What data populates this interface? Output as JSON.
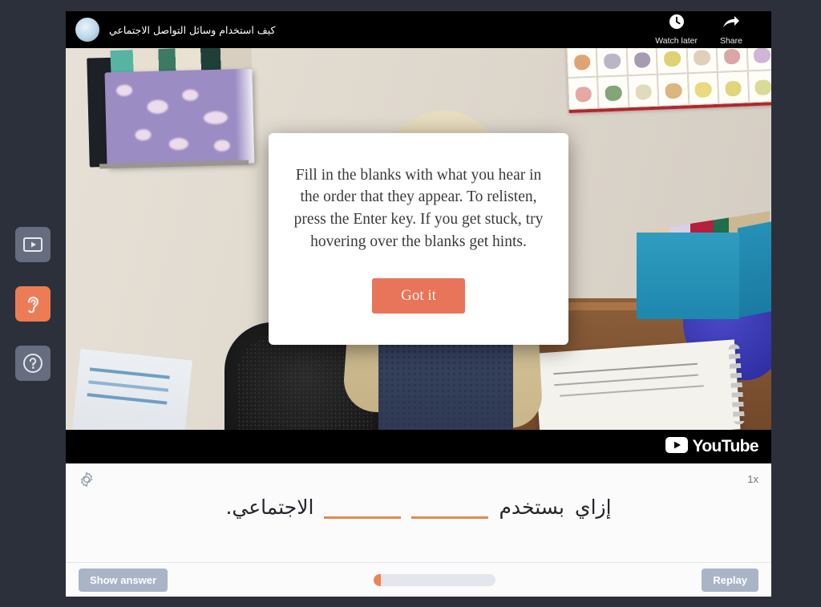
{
  "theme": {
    "page_bg": "#2b303b",
    "accent": "#e8745a",
    "accent_soft": "#ef8256",
    "button_gray": "#a9b4c6",
    "blank_underline": "#e08a50"
  },
  "sidebar": {
    "items": [
      {
        "name": "video-mode",
        "icon": "video-icon",
        "active": false
      },
      {
        "name": "listening-mode",
        "icon": "ear-icon",
        "active": true
      },
      {
        "name": "help",
        "icon": "question-mark-icon",
        "active": false
      }
    ]
  },
  "video": {
    "title": "كيف استخدام وسائل التواصل الاجتماعي",
    "avatar_icon": "channel-avatar",
    "actions": [
      {
        "label": "Watch later",
        "icon": "clock-icon"
      },
      {
        "label": "Share",
        "icon": "share-arrow-icon"
      }
    ],
    "brand": {
      "icon": "youtube-play-icon",
      "wordmark": "YouTube"
    }
  },
  "modal": {
    "body": "Fill in the blanks with what you hear in the order that they appear. To relisten, press the Enter key. If you get stuck, try hovering over the blanks get hints.",
    "button_label": "Got it"
  },
  "transcript": {
    "settings_icon": "gear-icon",
    "speed": "1x",
    "direction": "rtl",
    "tokens": [
      {
        "type": "word",
        "text": "إزاي"
      },
      {
        "type": "word",
        "text": "بستخدم"
      },
      {
        "type": "blank",
        "text": ""
      },
      {
        "type": "blank",
        "text": ""
      },
      {
        "type": "word",
        "text": "الاجتماعي."
      }
    ]
  },
  "controls": {
    "show_answer_label": "Show answer",
    "replay_label": "Replay",
    "progress_percent": 6
  }
}
